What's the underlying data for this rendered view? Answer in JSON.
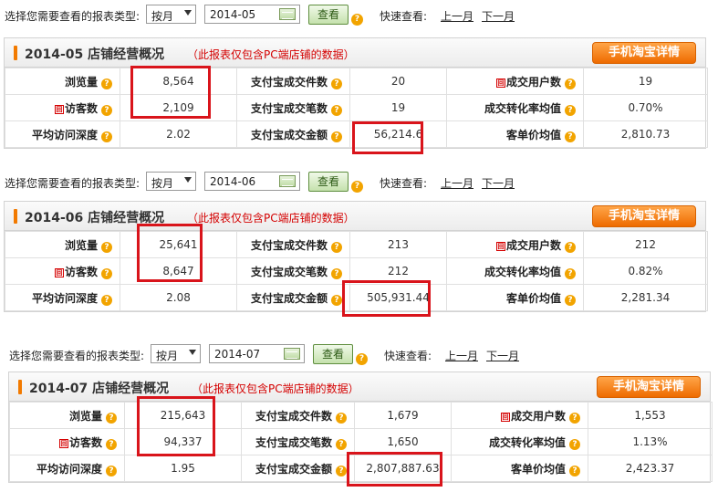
{
  "ui": {
    "query_label": "选择您需要查看的报表类型:",
    "period_option": "按月",
    "view_button": "查看",
    "help_symbol": "?",
    "quick_label": "快速查看:",
    "prev_month": "上一月",
    "next_month": "下一月",
    "panel_title_suffix": "店铺经营概况",
    "panel_note": "（此报表仅包含PC端店铺的数据）",
    "mobile_button": "手机淘宝详情",
    "new_tag": "回",
    "labels": {
      "pageviews": "浏览量",
      "visitors": "访客数",
      "avg_depth": "平均访问深度",
      "alipay_items": "支付宝成交件数",
      "alipay_orders": "支付宝成交笔数",
      "alipay_amount": "支付宝成交金额",
      "buyers": "成交用户数",
      "conversion": "成交转化率均值",
      "unit_price": "客单价均值"
    }
  },
  "reports": [
    {
      "date": "2014-05",
      "title_date": "2014-05",
      "pageviews": "8,564",
      "visitors": "2,109",
      "avg_depth": "2.02",
      "alipay_items": "20",
      "alipay_orders": "19",
      "alipay_amount": "56,214.6",
      "buyers": "19",
      "conversion": "0.70%",
      "unit_price": "2,810.73"
    },
    {
      "date": "2014-06",
      "title_date": "2014-06",
      "pageviews": "25,641",
      "visitors": "8,647",
      "avg_depth": "2.08",
      "alipay_items": "213",
      "alipay_orders": "212",
      "alipay_amount": "505,931.44",
      "buyers": "212",
      "conversion": "0.82%",
      "unit_price": "2,281.34"
    },
    {
      "date": "2014-07",
      "title_date": "2014-07",
      "pageviews": "215,643",
      "visitors": "94,337",
      "avg_depth": "1.95",
      "alipay_items": "1,679",
      "alipay_orders": "1,650",
      "alipay_amount": "2,807,887.63",
      "buyers": "1,553",
      "conversion": "1.13%",
      "unit_price": "2,423.37"
    }
  ],
  "highlight_color": "#d9141b",
  "accent_orange": "#f27a00",
  "note_red": "#d40000"
}
